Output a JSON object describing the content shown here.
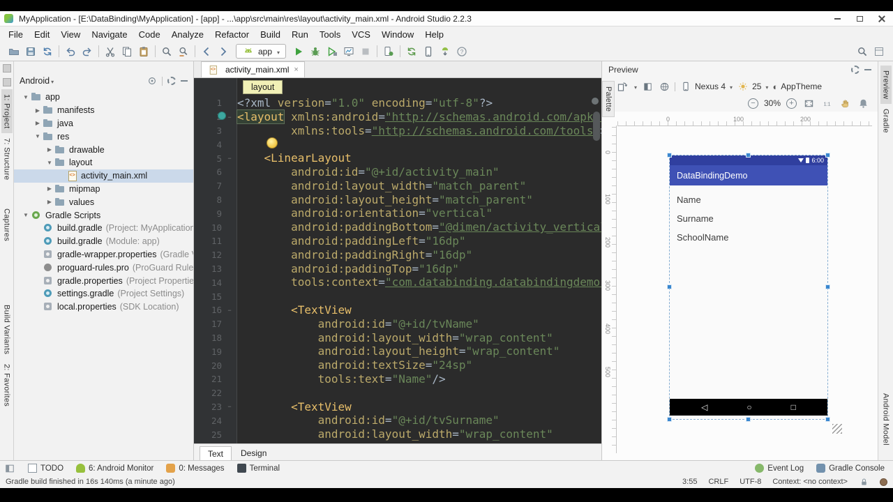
{
  "colors": {
    "accent_indigo": "#3f51b5",
    "phone_statusbar": "#303f9f",
    "editor_bg": "#2b2b2b",
    "xml_tag": "#e8bf6a",
    "xml_string": "#6a8759",
    "selection_handle": "#3a87cf"
  },
  "frame": {
    "title": "MyApplication - [E:\\DataBinding\\MyApplication] - [app] - ...\\app\\src\\main\\res\\layout\\activity_main.xml - Android Studio 2.2.3"
  },
  "menubar": {
    "items": [
      "File",
      "Edit",
      "View",
      "Navigate",
      "Code",
      "Analyze",
      "Refactor",
      "Build",
      "Run",
      "Tools",
      "VCS",
      "Window",
      "Help"
    ]
  },
  "toolbar": {
    "run_config_label": "app",
    "left_icons": [
      "open",
      "save-all",
      "sync",
      "sep",
      "undo",
      "redo",
      "sep",
      "cut",
      "copy",
      "paste",
      "sep",
      "find",
      "replace",
      "sep",
      "back",
      "forward"
    ],
    "run_icons": [
      "run",
      "debug",
      "coverage",
      "monitor",
      "stop",
      "sep",
      "attach-debugger",
      "sep",
      "gradle-sync",
      "avd-manager",
      "sdk-manager",
      "help"
    ],
    "right_icons": [
      "search",
      "collapse"
    ]
  },
  "left_strip": {
    "top": [
      {
        "label": "1: Project",
        "active": true
      },
      {
        "label": "7: Structure",
        "active": false
      }
    ],
    "middle": [
      {
        "label": "Captures",
        "active": false
      }
    ],
    "bottom": [
      {
        "label": "Build Variants",
        "active": false
      },
      {
        "label": "2: Favorites",
        "active": false
      }
    ]
  },
  "right_strip": {
    "top": [
      {
        "label": "Preview",
        "active": true
      },
      {
        "label": "Gradle",
        "active": false
      }
    ],
    "bottom": [
      {
        "label": "Android Model",
        "active": false
      }
    ]
  },
  "project": {
    "selector": "Android",
    "tree": [
      {
        "label": "app",
        "icon": "folder",
        "level": 0,
        "arrow": "down",
        "selected": false
      },
      {
        "label": "manifests",
        "icon": "folder",
        "level": 1,
        "arrow": "right",
        "selected": false
      },
      {
        "label": "java",
        "icon": "folder",
        "level": 1,
        "arrow": "right",
        "selected": false
      },
      {
        "label": "res",
        "icon": "folder",
        "level": 1,
        "arrow": "down",
        "selected": false
      },
      {
        "label": "drawable",
        "icon": "folder",
        "level": 2,
        "arrow": "right",
        "selected": false
      },
      {
        "label": "layout",
        "icon": "folder",
        "level": 2,
        "arrow": "down",
        "selected": false
      },
      {
        "label": "activity_main.xml",
        "icon": "xml",
        "level": 3,
        "arrow": "none",
        "selected": true
      },
      {
        "label": "mipmap",
        "icon": "folder",
        "level": 2,
        "arrow": "right",
        "selected": false
      },
      {
        "label": "values",
        "icon": "folder",
        "level": 2,
        "arrow": "right",
        "selected": false
      },
      {
        "label": "Gradle Scripts",
        "icon": "gradle-root",
        "level": 0,
        "arrow": "down",
        "selected": false
      },
      {
        "label": "build.gradle",
        "secondary": "(Project: MyApplication)",
        "icon": "gradle",
        "level": 1,
        "arrow": "none",
        "selected": false
      },
      {
        "label": "build.gradle",
        "secondary": "(Module: app)",
        "icon": "gradle",
        "level": 1,
        "arrow": "none",
        "selected": false
      },
      {
        "label": "gradle-wrapper.properties",
        "secondary": "(Gradle Version)",
        "icon": "properties",
        "level": 1,
        "arrow": "none",
        "selected": false
      },
      {
        "label": "proguard-rules.pro",
        "secondary": "(ProGuard Rules for app)",
        "icon": "proguard",
        "level": 1,
        "arrow": "none",
        "selected": false
      },
      {
        "label": "gradle.properties",
        "secondary": "(Project Properties)",
        "icon": "properties",
        "level": 1,
        "arrow": "none",
        "selected": false
      },
      {
        "label": "settings.gradle",
        "secondary": "(Project Settings)",
        "icon": "gradle",
        "level": 1,
        "arrow": "none",
        "selected": false
      },
      {
        "label": "local.properties",
        "secondary": "(SDK Location)",
        "icon": "properties",
        "level": 1,
        "arrow": "none",
        "selected": false
      }
    ]
  },
  "editor": {
    "tab": "activity_main.xml",
    "breadcrumb_tooltip": "layout",
    "bottom_tabs": [
      "Text",
      "Design"
    ],
    "lines": [
      {
        "n": 1,
        "tk": [
          [
            "p",
            "<?xml "
          ],
          [
            "a",
            "version"
          ],
          [
            "p",
            "="
          ],
          [
            "s",
            "\"1.0\""
          ],
          [
            "p",
            " "
          ],
          [
            "a",
            "encoding"
          ],
          [
            "p",
            "="
          ],
          [
            "s",
            "\"utf-8\""
          ],
          [
            "p",
            "?>"
          ]
        ]
      },
      {
        "n": 2,
        "fold": true,
        "tk": [
          [
            "t",
            "<layout",
            "hl"
          ],
          [
            "p",
            " "
          ],
          [
            "a",
            "xmlns:android"
          ],
          [
            "p",
            "="
          ],
          [
            "su",
            "\"http://schemas.android.com/apk/res/android\""
          ]
        ]
      },
      {
        "n": 3,
        "tk": [
          [
            "p",
            "        "
          ],
          [
            "a",
            "xmlns:tools"
          ],
          [
            "p",
            "="
          ],
          [
            "su",
            "\"http://schemas.android.com/tools\""
          ],
          [
            "p",
            ">"
          ]
        ]
      },
      {
        "n": 4,
        "tk": []
      },
      {
        "n": 5,
        "fold": true,
        "tk": [
          [
            "p",
            "    "
          ],
          [
            "t",
            "<LinearLayout"
          ]
        ]
      },
      {
        "n": 6,
        "tk": [
          [
            "p",
            "        "
          ],
          [
            "a",
            "android:id"
          ],
          [
            "p",
            "="
          ],
          [
            "s",
            "\"@+id/activity_main\""
          ]
        ]
      },
      {
        "n": 7,
        "tk": [
          [
            "p",
            "        "
          ],
          [
            "a",
            "android:layout_width"
          ],
          [
            "p",
            "="
          ],
          [
            "s",
            "\"match_parent\""
          ]
        ]
      },
      {
        "n": 8,
        "tk": [
          [
            "p",
            "        "
          ],
          [
            "a",
            "android:layout_height"
          ],
          [
            "p",
            "="
          ],
          [
            "s",
            "\"match_parent\""
          ]
        ]
      },
      {
        "n": 9,
        "tk": [
          [
            "p",
            "        "
          ],
          [
            "a",
            "android:orientation"
          ],
          [
            "p",
            "="
          ],
          [
            "s",
            "\"vertical\""
          ]
        ]
      },
      {
        "n": 10,
        "tk": [
          [
            "p",
            "        "
          ],
          [
            "a",
            "android:paddingBottom"
          ],
          [
            "p",
            "="
          ],
          [
            "su",
            "\"@dimen/activity_vertical_margin\""
          ]
        ]
      },
      {
        "n": 11,
        "tk": [
          [
            "p",
            "        "
          ],
          [
            "a",
            "android:paddingLeft"
          ],
          [
            "p",
            "="
          ],
          [
            "s",
            "\"16dp\""
          ]
        ]
      },
      {
        "n": 12,
        "tk": [
          [
            "p",
            "        "
          ],
          [
            "a",
            "android:paddingRight"
          ],
          [
            "p",
            "="
          ],
          [
            "s",
            "\"16dp\""
          ]
        ]
      },
      {
        "n": 13,
        "tk": [
          [
            "p",
            "        "
          ],
          [
            "a",
            "android:paddingTop"
          ],
          [
            "p",
            "="
          ],
          [
            "s",
            "\"16dp\""
          ]
        ]
      },
      {
        "n": 14,
        "tk": [
          [
            "p",
            "        "
          ],
          [
            "a",
            "tools:context"
          ],
          [
            "p",
            "="
          ],
          [
            "su",
            "\"com.databinding.databindingdemo.MainActivity\""
          ],
          [
            "p",
            ">"
          ]
        ]
      },
      {
        "n": 15,
        "tk": []
      },
      {
        "n": 16,
        "fold": true,
        "tk": [
          [
            "p",
            "        "
          ],
          [
            "t",
            "<TextView"
          ]
        ]
      },
      {
        "n": 17,
        "tk": [
          [
            "p",
            "            "
          ],
          [
            "a",
            "android:id"
          ],
          [
            "p",
            "="
          ],
          [
            "s",
            "\"@+id/tvName\""
          ]
        ]
      },
      {
        "n": 18,
        "tk": [
          [
            "p",
            "            "
          ],
          [
            "a",
            "android:layout_width"
          ],
          [
            "p",
            "="
          ],
          [
            "s",
            "\"wrap_content\""
          ]
        ]
      },
      {
        "n": 19,
        "tk": [
          [
            "p",
            "            "
          ],
          [
            "a",
            "android:layout_height"
          ],
          [
            "p",
            "="
          ],
          [
            "s",
            "\"wrap_content\""
          ]
        ]
      },
      {
        "n": 20,
        "tk": [
          [
            "p",
            "            "
          ],
          [
            "a",
            "android:textSize"
          ],
          [
            "p",
            "="
          ],
          [
            "s",
            "\"24sp\""
          ]
        ]
      },
      {
        "n": 21,
        "tk": [
          [
            "p",
            "            "
          ],
          [
            "a",
            "tools:text"
          ],
          [
            "p",
            "="
          ],
          [
            "s",
            "\"Name\""
          ],
          [
            "p",
            "/>"
          ]
        ]
      },
      {
        "n": 22,
        "tk": []
      },
      {
        "n": 23,
        "fold": true,
        "tk": [
          [
            "p",
            "        "
          ],
          [
            "t",
            "<TextView"
          ]
        ]
      },
      {
        "n": 24,
        "tk": [
          [
            "p",
            "            "
          ],
          [
            "a",
            "android:id"
          ],
          [
            "p",
            "="
          ],
          [
            "s",
            "\"@+id/tvSurname\""
          ]
        ]
      },
      {
        "n": 25,
        "tk": [
          [
            "p",
            "            "
          ],
          [
            "a",
            "android:layout_width"
          ],
          [
            "p",
            "="
          ],
          [
            "s",
            "\"wrap_content\""
          ]
        ]
      }
    ]
  },
  "preview": {
    "title": "Preview",
    "palette_label": "Palette",
    "device": "Nexus 4",
    "api": "25",
    "theme": "AppTheme",
    "zoom": "30%",
    "ruler_top": [
      "0",
      "100",
      "200"
    ],
    "ruler_left": [
      "0",
      "100",
      "200",
      "300",
      "400",
      "500"
    ],
    "phone": {
      "time": "6:00",
      "app_title": "DataBindingDemo",
      "labels": [
        "Name",
        "Surname",
        "SchoolName"
      ],
      "nav": [
        "back",
        "home",
        "recents"
      ]
    }
  },
  "status_tabs": {
    "left": [
      {
        "label": "TODO",
        "icon": "todo"
      },
      {
        "label": "6: Android Monitor",
        "icon": "android"
      },
      {
        "label": "0: Messages",
        "icon": "messages"
      },
      {
        "label": "Terminal",
        "icon": "terminal"
      }
    ],
    "right": [
      {
        "label": "Event Log",
        "icon": "event-log"
      },
      {
        "label": "Gradle Console",
        "icon": "gradle-console"
      }
    ]
  },
  "statusbar": {
    "message": "Gradle build finished in 16s 140ms (a minute ago)",
    "right_items": [
      "3:55",
      "CRLF",
      "UTF-8",
      "Context: <no context>"
    ]
  }
}
